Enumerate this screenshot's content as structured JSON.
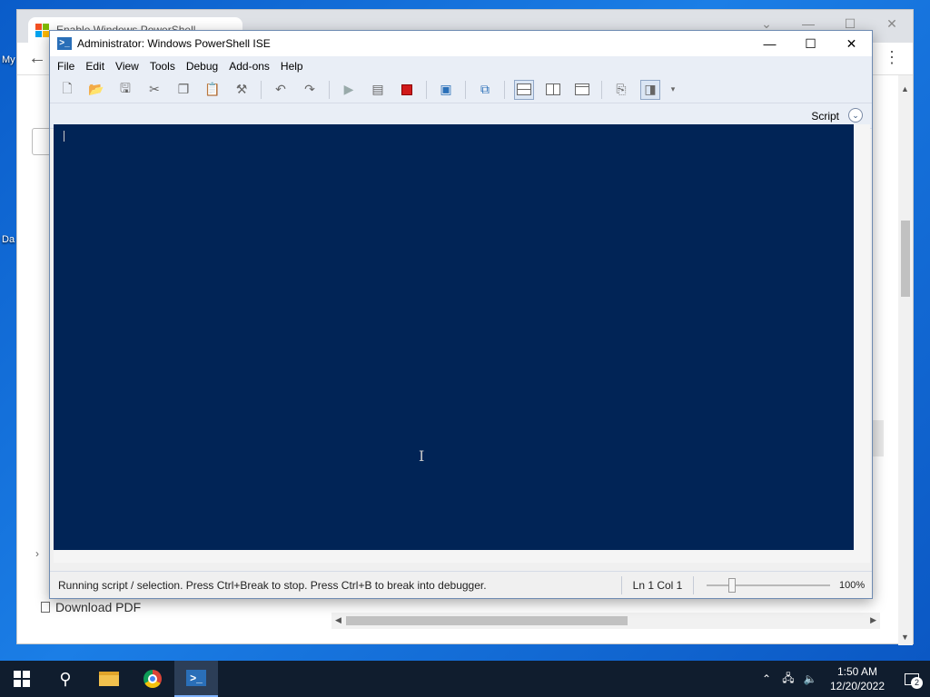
{
  "desktop": {
    "icon_label_1": "My",
    "icon_label_2": "Da"
  },
  "browser": {
    "tab_title": "Enable Windows PowerShell...",
    "tab_ctrls": {
      "collapse": "⌄",
      "minimize": "—",
      "maximize": "☐",
      "close": "✕"
    },
    "download_pdf": "Download PDF"
  },
  "ise": {
    "title": "Administrator: Windows PowerShell ISE",
    "window_ctrls": {
      "minimize": "—",
      "maximize": "☐",
      "close": "✕"
    },
    "menu": [
      "File",
      "Edit",
      "View",
      "Tools",
      "Debug",
      "Add-ons",
      "Help"
    ],
    "script_label": "Script",
    "status": {
      "message": "Running script / selection.  Press Ctrl+Break to stop.  Press Ctrl+B to break into debugger.",
      "ln": "Ln 1",
      "col": "Col 1",
      "zoom": "100%"
    },
    "console_bg": "#012456"
  },
  "taskbar": {
    "time": "1:50 AM",
    "date": "12/20/2022",
    "notification_count": "2"
  }
}
